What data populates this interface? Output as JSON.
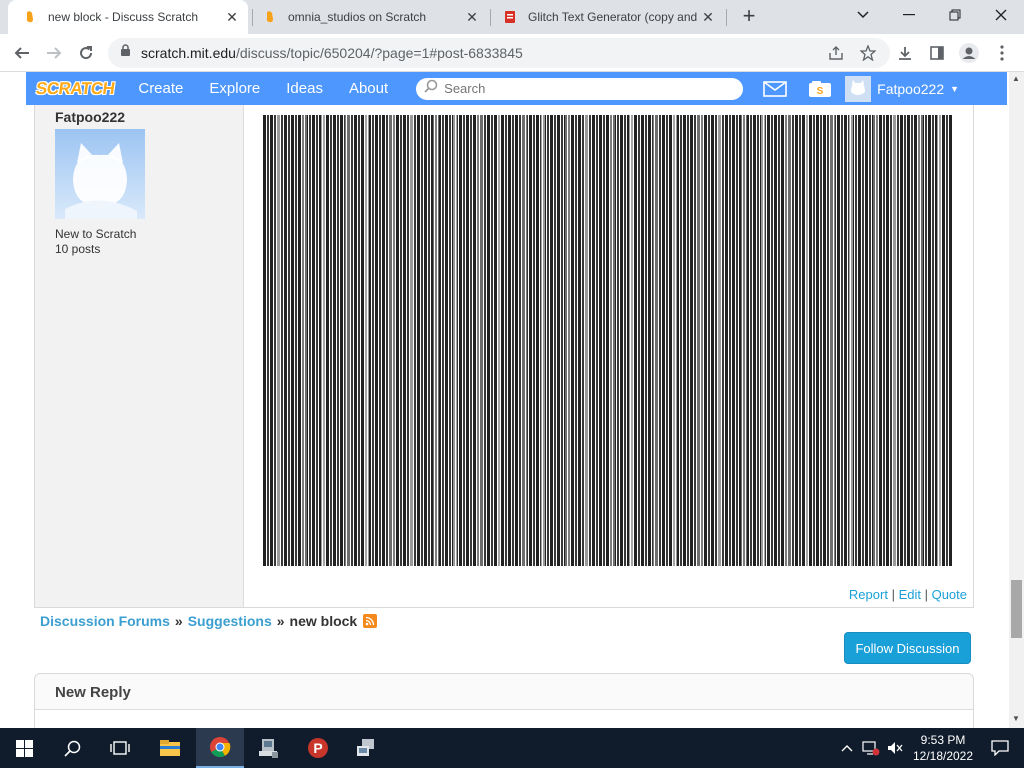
{
  "browser": {
    "tabs": [
      {
        "label": "new block - Discuss Scratch",
        "active": true
      },
      {
        "label": "omnia_studios on Scratch",
        "active": false
      },
      {
        "label": "Glitch Text Generator (copy and p",
        "active": false
      }
    ],
    "url_main": "scratch.mit.edu",
    "url_rest": "/discuss/topic/650204/?page=1#post-6833845"
  },
  "scratch_nav": {
    "logo": "SCRATCH",
    "links": [
      "Create",
      "Explore",
      "Ideas",
      "About"
    ],
    "search_placeholder": "Search",
    "username": "Fatpoo222"
  },
  "post": {
    "author": "Fatpoo222",
    "rank": "New to Scratch",
    "post_count": "10 posts",
    "actions": {
      "report": "Report",
      "edit": "Edit",
      "quote": "Quote"
    }
  },
  "breadcrumb": {
    "forum": "Discussion Forums",
    "category": "Suggestions",
    "topic": "new block"
  },
  "follow_button": "Follow Discussion",
  "reply": {
    "title": "New Reply"
  },
  "taskbar": {
    "time": "9:53 PM",
    "date": "12/18/2022"
  },
  "colors": {
    "scratch_blue": "#4d97ff",
    "link_blue": "#3b9fd1",
    "button_blue": "#1aa0d8",
    "taskbar": "#101c2b"
  }
}
